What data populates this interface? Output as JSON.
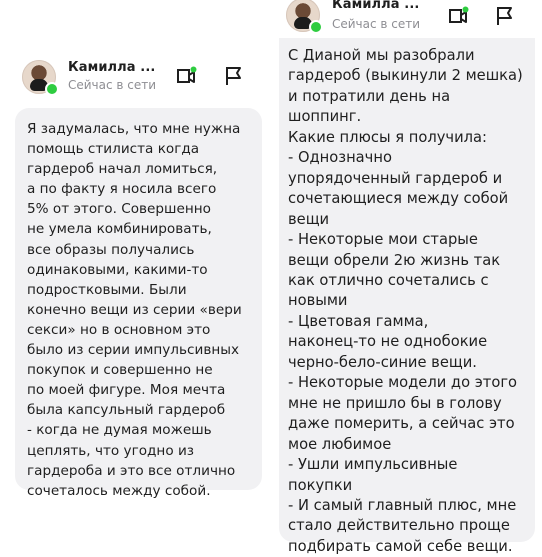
{
  "colors": {
    "bubble_bg": "#f1f1f3",
    "online": "#2ecc40",
    "status_text": "#8e8e93",
    "text": "#1f1f1f"
  },
  "left_chat": {
    "contact_name": "Камилла ...",
    "status": "Сейчас в сети",
    "icons": [
      "video-call-icon",
      "flag-icon"
    ],
    "message": "Я задумалась, что мне нужна\nпомощь стилиста когда\nгардероб начал ломиться,\nа по факту я носила всего\n5% от этого. Совершенно\nне умела комбинировать,\nвсе образы получались\nодинаковыми, какими-то\nподростковыми. Были\nконечно вещи из серии «вери\nсекси» но в основном это\nбыло из серии импульсивных\nпокупок и совершенно не\nпо моей фигуре. Моя мечта\nбыла капсульный гардероб\n- когда не думая можешь\nцеплять, что угодно из\nгардероба и это все отлично\nсочеталось между собой."
  },
  "right_chat": {
    "contact_name": "Камилла ...",
    "status": "Сейчас в сети",
    "icons": [
      "video-call-icon",
      "flag-icon"
    ],
    "message": "С Дианой мы разобрали\nгардероб (выкинули 2 мешка)\nи потратили день на шоппинг.\nКакие плюсы я получила:\n- Однозначно\nупорядоченный гардероб и\nсочетающиеся между собой\nвещи\n- Некоторые мои старые\nвещи обрели 2ю жизнь так\nкак отлично сочетались с\nновыми\n- Цветовая гамма,\nнаконец-то не однобокие\nчерно-бело-синие вещи.\n- Некоторые модели до этого\nмне не пришло бы в голову\nдаже померить, а сейчас это\nмое любимое\n- Ушли импульсивные\nпокупки\n- И самый главный плюс, мне\nстало действительно проще\nподбирать самой себе вещи."
  }
}
